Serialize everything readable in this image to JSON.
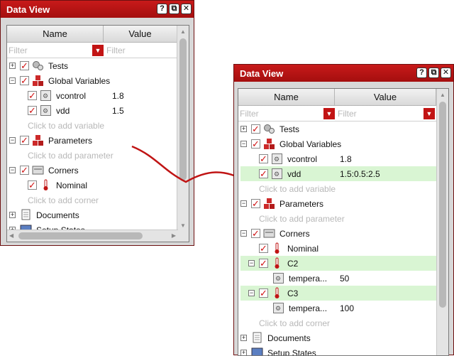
{
  "left": {
    "title": "Data View",
    "columns": {
      "name": "Name",
      "value": "Value"
    },
    "filter_placeholder": "Filter",
    "rows": {
      "tests": "Tests",
      "global_variables": "Global Variables",
      "vcontrol": {
        "name": "vcontrol",
        "value": "1.8"
      },
      "vdd": {
        "name": "vdd",
        "value": "1.5"
      },
      "add_variable": "Click to add variable",
      "parameters": "Parameters",
      "add_parameter": "Click to add parameter",
      "corners": "Corners",
      "nominal": "Nominal",
      "add_corner": "Click to add corner",
      "documents": "Documents",
      "setup_states": "Setup States"
    }
  },
  "right": {
    "title": "Data View",
    "columns": {
      "name": "Name",
      "value": "Value"
    },
    "filter_placeholder": "Filter",
    "rows": {
      "tests": "Tests",
      "global_variables": "Global Variables",
      "vcontrol": {
        "name": "vcontrol",
        "value": "1.8"
      },
      "vdd": {
        "name": "vdd",
        "value": "1.5:0.5:2.5"
      },
      "add_variable": "Click to add variable",
      "parameters": "Parameters",
      "add_parameter": "Click to add parameter",
      "corners": "Corners",
      "nominal": "Nominal",
      "c2": "C2",
      "c2_temp": {
        "name": "tempera...",
        "value": "50"
      },
      "c3": "C3",
      "c3_temp": {
        "name": "tempera...",
        "value": "100"
      },
      "add_corner": "Click to add corner",
      "documents": "Documents",
      "setup_states": "Setup States"
    }
  },
  "colors": {
    "accent": "#c01414",
    "highlight": "#d9f5d3",
    "arrow": "#c01414"
  },
  "titlebar_buttons": [
    "?",
    "⧉",
    "✕"
  ],
  "icons": [
    "tests-icon",
    "variables-icon",
    "var-icon",
    "parameters-icon",
    "corners-icon",
    "thermometer-icon",
    "documents-icon",
    "setup-states-icon"
  ]
}
